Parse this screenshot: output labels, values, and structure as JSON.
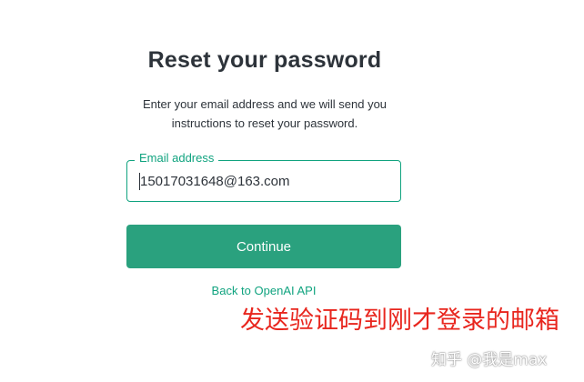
{
  "form": {
    "title": "Reset your password",
    "description": "Enter your email address and we will send you instructions to reset your password.",
    "email_label": "Email address",
    "email_value": "15017031648@163.com",
    "continue_label": "Continue",
    "back_link": "Back to OpenAI API"
  },
  "overlay": {
    "annotation": "发送验证码到刚才登录的邮箱",
    "watermark": "知乎 @我是max"
  },
  "colors": {
    "accent": "#10a37f",
    "button": "#2aa17e",
    "annotation": "#e8261e"
  }
}
